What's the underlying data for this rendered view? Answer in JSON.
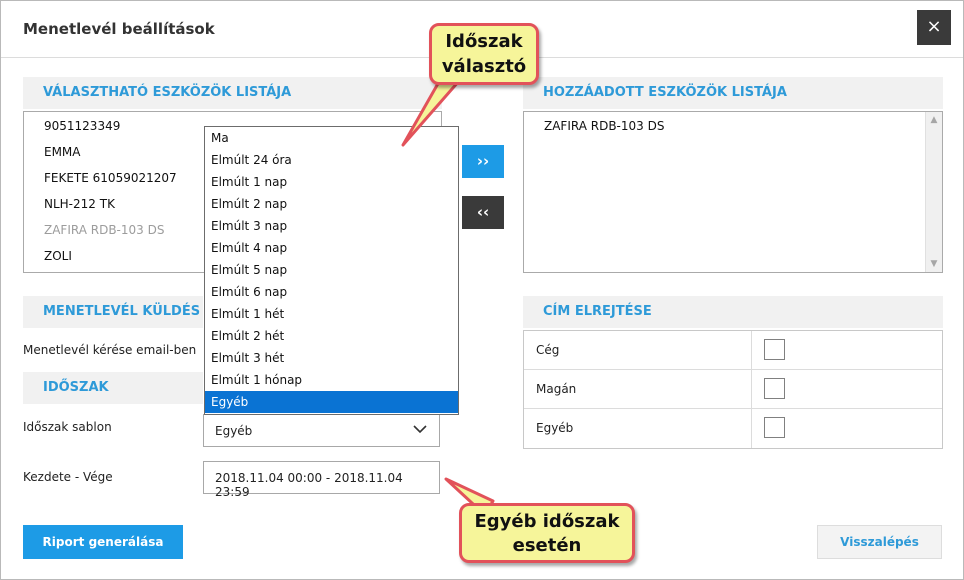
{
  "dialog": {
    "title": "Menetlevél beállítások",
    "close_symbol": "×"
  },
  "available_list": {
    "header": "VÁLASZTHATÓ ESZKÖZÖK LISTÁJA",
    "items": [
      "9051123349",
      "EMMA",
      "FEKETE 61059021207",
      "NLH-212 TK",
      "ZAFIRA RDB-103 DS",
      "ZOLI"
    ]
  },
  "added_list": {
    "header": "HOZZÁADOTT ESZKÖZÖK LISTÁJA",
    "items": [
      "ZAFIRA RDB-103 DS"
    ]
  },
  "move_buttons": {
    "add_label": "››",
    "remove_label": "‹‹"
  },
  "send_section": {
    "header": "MENETLEVÉL KÜLDÉS",
    "email_label": "Menetlevél kérése email-ben"
  },
  "period_section": {
    "header": "IDŐSZAK",
    "template_label": "Időszak sablon",
    "template_value": "Egyéb",
    "range_label": "Kezdete - Vége",
    "range_value": "2018.11.04 00:00 - 2018.11.04 23:59"
  },
  "dropdown": {
    "options": [
      "Ma",
      "Elmúlt 24 óra",
      "Elmúlt 1 nap",
      "Elmúlt 2 nap",
      "Elmúlt 3 nap",
      "Elmúlt 4 nap",
      "Elmúlt 5 nap",
      "Elmúlt 6 nap",
      "Elmúlt 1 hét",
      "Elmúlt 2 hét",
      "Elmúlt 3 hét",
      "Elmúlt 1 hónap",
      "Egyéb"
    ],
    "selected": "Egyéb"
  },
  "hide_address": {
    "header": "CÍM ELREJTÉSE",
    "rows": [
      "Cég",
      "Magán",
      "Egyéb"
    ]
  },
  "buttons": {
    "generate": "Riport generálása",
    "back": "Visszalépés"
  },
  "callouts": {
    "period_selector": [
      "Időszak",
      "választó"
    ],
    "other_period": [
      "Egyéb időszak",
      "esetén"
    ]
  },
  "colors": {
    "accent": "#2e9ad8",
    "primary_button": "#1d9be6",
    "selected_option": "#0a73d3",
    "callout_fill": "#f6f59a",
    "callout_border": "#e2525a"
  }
}
